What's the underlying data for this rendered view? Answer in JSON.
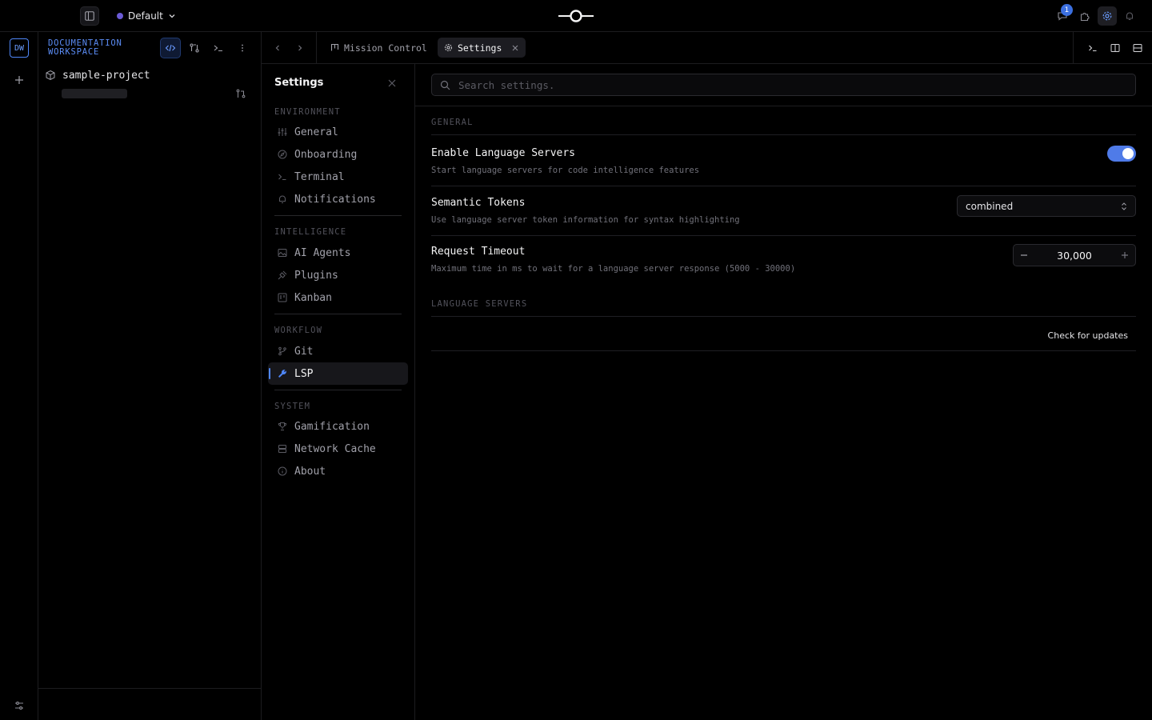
{
  "colors": {
    "accent": "#4f86f7",
    "env_dot": "#6b5bd6",
    "badge": "#3b6fe0",
    "toggle_on": "#4f7be8",
    "icon": "#8a8a93",
    "icon_dim": "#5b5b63"
  },
  "topbar": {
    "environment": "Default",
    "notification_count": "1",
    "icons": [
      "sidebar-toggle-icon",
      "logo",
      "notifications-icon",
      "plugins-icon",
      "settings-gear-icon",
      "bell-icon"
    ]
  },
  "rail": {
    "workspace_initials": "DW"
  },
  "project_panel": {
    "workspace_name": "DOCUMENTATION WORKSPACE",
    "project_name": "sample-project"
  },
  "tabs": [
    {
      "label": "Mission Control",
      "icon": "kanban-icon",
      "active": false
    },
    {
      "label": "Settings",
      "icon": "gear-icon",
      "active": true
    }
  ],
  "settings_nav": {
    "title": "Settings",
    "sections": [
      {
        "label": "ENVIRONMENT",
        "items": [
          "General",
          "Onboarding",
          "Terminal",
          "Notifications"
        ]
      },
      {
        "label": "INTELLIGENCE",
        "items": [
          "AI Agents",
          "Plugins",
          "Kanban"
        ]
      },
      {
        "label": "WORKFLOW",
        "items": [
          "Git",
          "LSP"
        ]
      },
      {
        "label": "SYSTEM",
        "items": [
          "Gamification",
          "Network Cache",
          "About"
        ]
      }
    ],
    "active_item": "LSP"
  },
  "settings_main": {
    "search_placeholder": "Search settings.",
    "general_label": "GENERAL",
    "enable_lsp": {
      "title": "Enable Language Servers",
      "description": "Start language servers for code intelligence features",
      "enabled": true
    },
    "semantic_tokens": {
      "title": "Semantic Tokens",
      "description": "Use language server token information for syntax highlighting",
      "value": "combined"
    },
    "request_timeout": {
      "title": "Request Timeout",
      "description": "Maximum time in ms to wait for a language server response (5000 - 30000)",
      "value": "30,000"
    },
    "language_servers_label": "LANGUAGE SERVERS",
    "check_updates_label": "Check for updates"
  }
}
